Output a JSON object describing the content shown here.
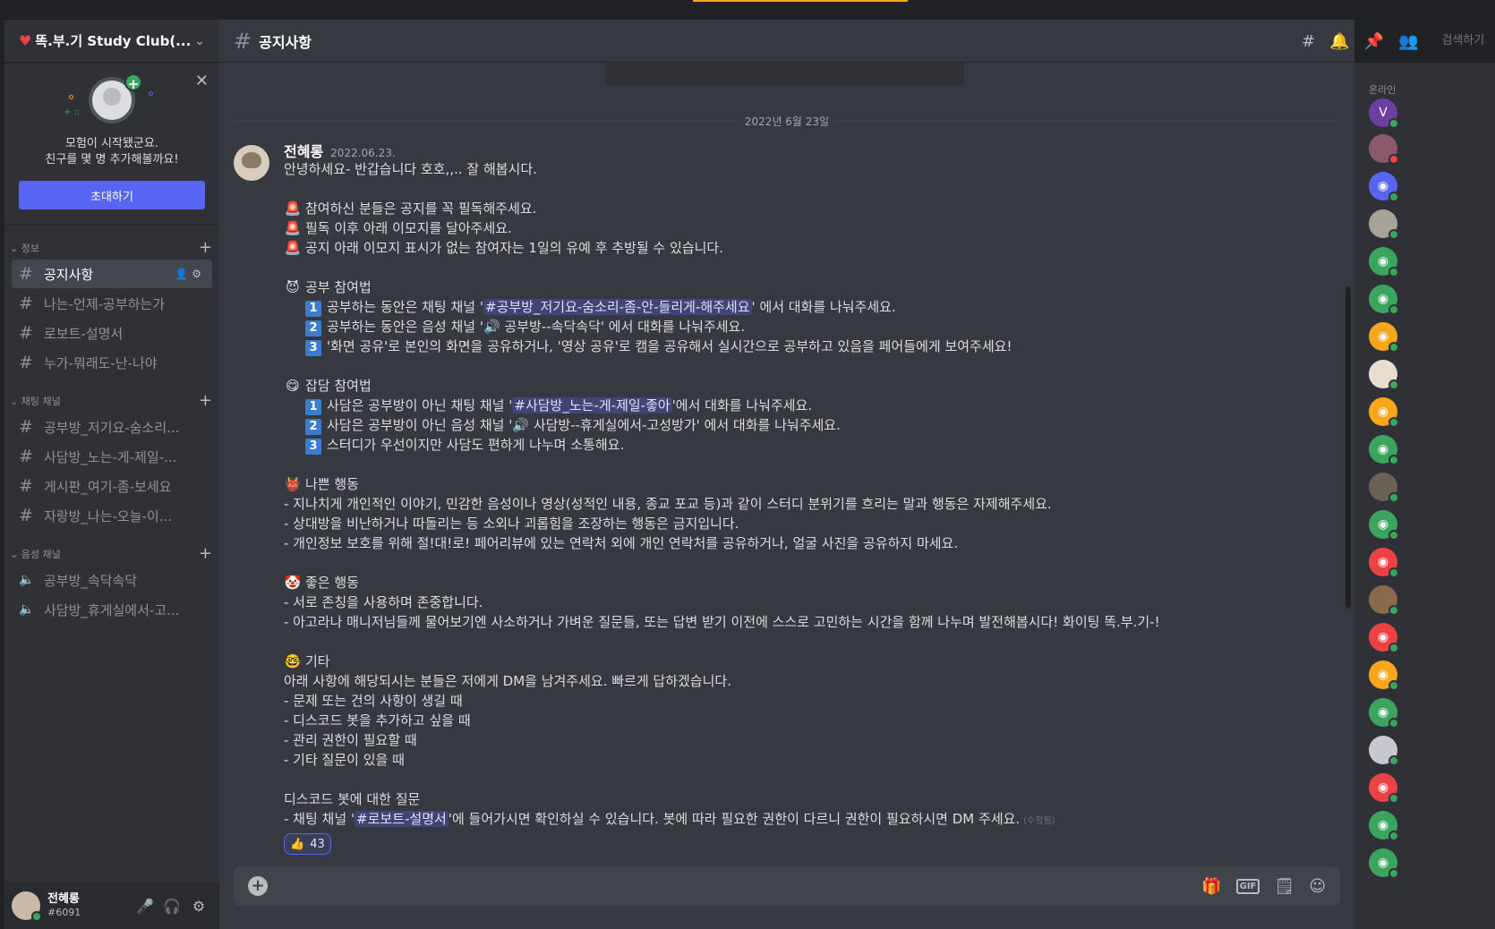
{
  "server": {
    "name": "똑.부.기 Study Club(...",
    "heart_icon": "heart-icon",
    "chevron_icon": "chevron-down-icon"
  },
  "invite": {
    "line1": "모험이 시작됐군요.",
    "line2": "친구를 몇 명 추가해볼까요!",
    "button": "초대하기",
    "close_icon": "close-icon"
  },
  "categories": [
    {
      "label": "정보",
      "channels": [
        {
          "name": "공지사항",
          "icon": "#",
          "active": true
        },
        {
          "name": "나는-언제-공부하는가",
          "icon": "#"
        },
        {
          "name": "로보트-설명서",
          "icon": "#"
        },
        {
          "name": "누가-뭐래도-난-나야",
          "icon": "#"
        }
      ]
    },
    {
      "label": "채팅 채널",
      "channels": [
        {
          "name": "공부방_저기요-숨소리...",
          "icon": "#"
        },
        {
          "name": "사담방_노는-게-제일-...",
          "icon": "#"
        },
        {
          "name": "게시판_여기-좀-보세요",
          "icon": "#"
        },
        {
          "name": "자랑방_나는-오늘-이...",
          "icon": "#"
        }
      ]
    },
    {
      "label": "음성 채널",
      "channels": [
        {
          "name": "공부방_속닥속닥",
          "icon": "🔊"
        },
        {
          "name": "사담방_휴게실에서-고...",
          "icon": "🔊"
        }
      ]
    }
  ],
  "user": {
    "name": "전혜롱",
    "tag": "#6091"
  },
  "channel_header": {
    "hash": "#",
    "title": "공지사항",
    "search_placeholder": "검색하기"
  },
  "date_divider": "2022년 6월 23일",
  "message": {
    "author": "전혜롱",
    "timestamp": "2022.06.23.",
    "greeting": "안녕하세요- 반갑습니다 호호,,.. 잘 해봅시다.",
    "rules": [
      "참여하신 분들은 공지를 꼭 필독해주세요.",
      "필독 이후 아래 이모지를 달아주세요.",
      "공지 아래 이모지 표시가 없는 참여자는 1일의 유예 후 추방될 수 있습니다."
    ],
    "study": {
      "title": "공부 참여법",
      "i1_pre": "공부하는 동안은 채팅 채널 '",
      "i1_mention": "#공부방_저기요-숨소리-좀-안-들리게-해주세요",
      "i1_post": "' 에서 대화를 나눠주세요.",
      "i2_pre": "공부하는 동안은 음성 채널 '",
      "i2_voice": "공부방--속닥속닥",
      "i2_post": "' 에서 대화를 나눠주세요.",
      "i3": "'화면 공유'로 본인의 화면을 공유하거나, '영상 공유'로 캠을 공유해서 실시간으로 공부하고 있음을 페어들에게 보여주세요!"
    },
    "chat": {
      "title": "잡담 참여법",
      "i1_pre": "사담은 공부방이 아닌 채팅 채널 '",
      "i1_mention": "#사담방_노는-게-제일-좋아",
      "i1_post": "'에서 대화를 나눠주세요.",
      "i2_pre": "사담은 공부방이 아닌 음성 채널 '",
      "i2_voice": "사담방--휴게실에서-고성방가",
      "i2_post": "' 에서 대화를 나눠주세요.",
      "i3": "스터디가 우선이지만 사담도 편하게 나누며 소통해요."
    },
    "bad": {
      "title": "나쁜 행동",
      "lines": [
        "- 지나치게 개인적인 이야기, 민감한 음성이나 영상(성적인 내용, 종교 포교 등)과 같이 스터디 분위기를 흐리는 말과 행동은 자제해주세요.",
        "- 상대방을 비난하거나 따돌리는 등 소외나 괴롭힘을 조장하는 행동은 금지입니다.",
        "- 개인정보 보호를 위해 절!대!로! 페어리뷰에 있는 연락처 외에 개인 연락처를 공유하거나, 얼굴 사진을 공유하지 마세요."
      ]
    },
    "good": {
      "title": "좋은 행동",
      "lines": [
        "- 서로 존칭을 사용하며 존중합니다.",
        "- 아고라나 매니저님들께 물어보기엔 사소하거나 가벼운 질문들, 또는 답변 받기 이전에 스스로 고민하는 시간을 함께 나누며 발전해봅시다! 화이팅 똑.부.기-!"
      ]
    },
    "etc": {
      "title": "기타",
      "lines": [
        "아래 사항에 해당되시는 분들은 저에게 DM을 남겨주세요. 빠르게 답하겠습니다.",
        "- 문제 또는 건의 사항이 생길 때",
        "- 디스코드 봇을 추가하고 싶을 때",
        "- 관리 권한이 필요할 때",
        "- 기타 질문이 있을 때"
      ]
    },
    "bot": {
      "title": "디스코드 봇에 대한 질문",
      "pre": "- 채팅 채널 '",
      "mention": "#로보트-설명서",
      "post": "'에 들어가시면 확인하실 수 있습니다. 봇에 따라 필요한 권한이 다르니 권한이 필요하시면 DM 주세요.",
      "edited": "(수정됨)"
    },
    "reaction": {
      "emoji": "👍",
      "count": "43"
    }
  },
  "members": {
    "title": "온라인"
  },
  "colors": {
    "accent": "#5865f2",
    "online": "#3ba55d",
    "dnd": "#ed4245"
  }
}
